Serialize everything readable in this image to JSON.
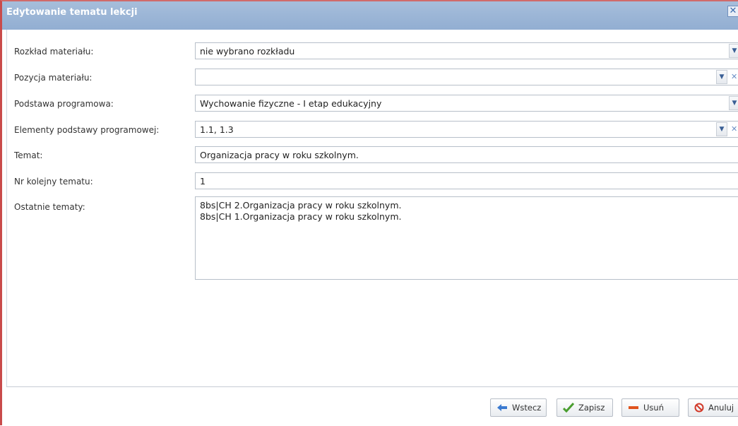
{
  "dialog": {
    "title": "Edytowanie tematu lekcji",
    "close_icon": "close-icon"
  },
  "form": {
    "rozklad": {
      "label": "Rozkład materiału:",
      "value": "nie wybrano rozkładu"
    },
    "pozycja": {
      "label": "Pozycja materiału:",
      "value": ""
    },
    "podstawa": {
      "label": "Podstawa programowa:",
      "value": "Wychowanie fizyczne - I etap edukacyjny"
    },
    "elementy": {
      "label": "Elementy podstawy programowej:",
      "value": "1.1, 1.3"
    },
    "temat": {
      "label": "Temat:",
      "value": "Organizacja pracy w roku szkolnym."
    },
    "nr": {
      "label": "Nr kolejny tematu:",
      "value": "1"
    },
    "ostatnie": {
      "label": "Ostatnie tematy:",
      "lines": [
        "8bs|CH 2.Organizacja pracy w roku szkolnym.",
        "8bs|CH 1.Organizacja pracy w roku szkolnym."
      ]
    }
  },
  "buttons": {
    "wstecz": "Wstecz",
    "zapisz": "Zapisz",
    "usun": "Usuń",
    "anuluj": "Anuluj"
  },
  "colors": {
    "titlebar": "#a6bedb",
    "accent_blue": "#3b6cae",
    "save_green": "#4a9e2f",
    "delete_orange": "#e0531d",
    "cancel_red": "#d23a2a"
  }
}
